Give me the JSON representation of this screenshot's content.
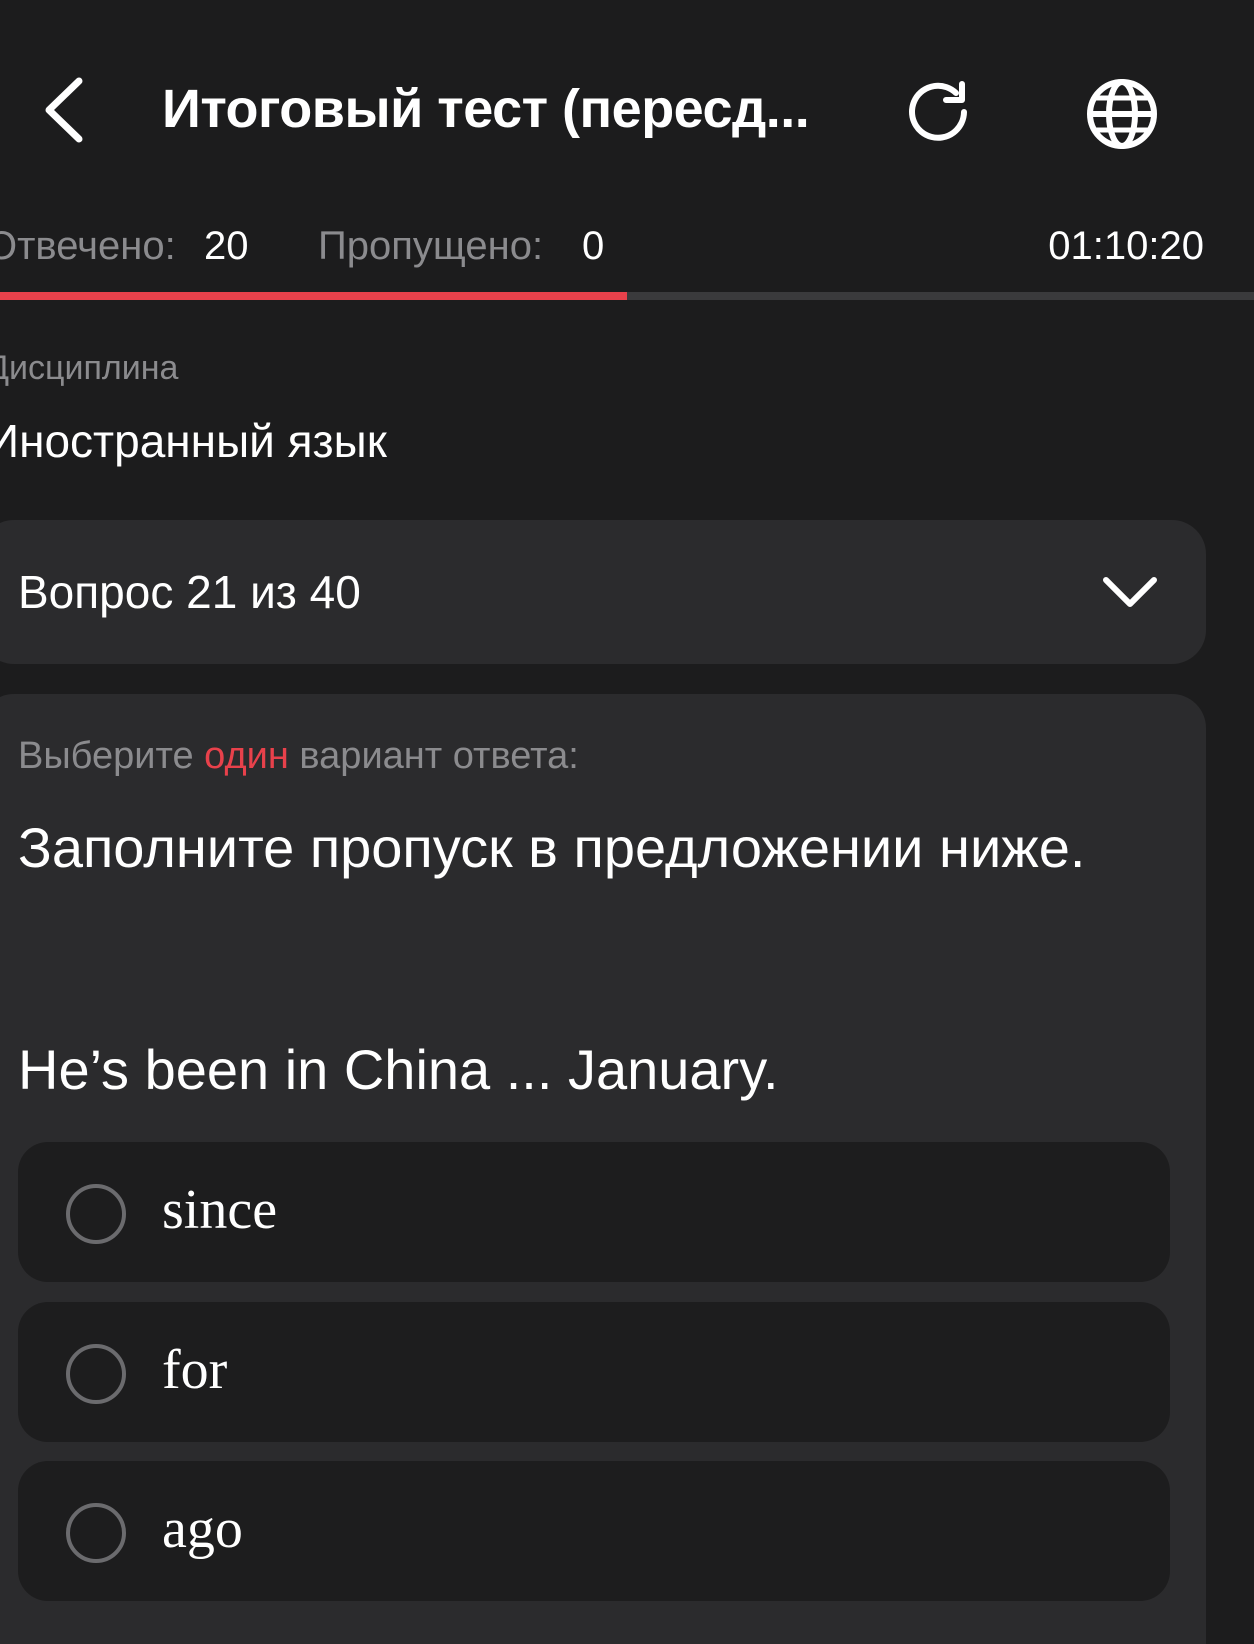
{
  "header": {
    "title": "Итоговый тест (пересд...",
    "back_icon": "chevron-left-icon",
    "refresh_icon": "refresh-icon",
    "language_icon": "globe-icon"
  },
  "stats": {
    "answered_label": "Отвечено:",
    "answered_value": "20",
    "skipped_label": "Пропущено:",
    "skipped_value": "0",
    "timer": "01:10:20"
  },
  "progress": {
    "fraction": 0.5,
    "fill_color": "#e8414b",
    "track_color": "#3a3a3c"
  },
  "discipline": {
    "label": "Дисциплина",
    "value": "Иностранный язык"
  },
  "question_selector": {
    "label": "Вопрос 21 из 40",
    "icon": "chevron-down-icon"
  },
  "question": {
    "instruction_prefix": "Выберите ",
    "instruction_accent": "один",
    "instruction_suffix": " вариант ответа:",
    "text": "Заполните пропуск в предложении ниже.",
    "sentence": "He’s been in China ... January.",
    "options": [
      {
        "label": "since",
        "selected": false
      },
      {
        "label": "for",
        "selected": false
      },
      {
        "label": "ago",
        "selected": false
      }
    ]
  },
  "colors": {
    "background": "#1c1c1d",
    "card": "#2b2b2d",
    "option": "#1d1d1e",
    "accent": "#e8414b",
    "muted_text": "#8b8b8e"
  }
}
